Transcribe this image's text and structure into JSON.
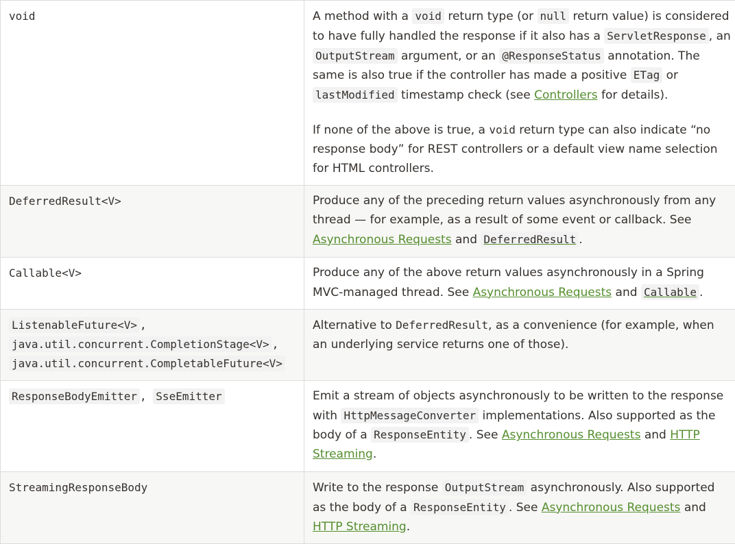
{
  "rows": [
    {
      "key": [
        "void"
      ],
      "desc": [
        [
          {
            "t": "A method with a "
          },
          {
            "c": "void"
          },
          {
            "t": " return type (or "
          },
          {
            "c": "null"
          },
          {
            "t": " return value) is considered to have fully handled the response if it also has a "
          },
          {
            "c": "ServletResponse"
          },
          {
            "t": ", an "
          },
          {
            "c": "OutputStream"
          },
          {
            "t": " argument, or an "
          },
          {
            "c": "@ResponseStatus"
          },
          {
            "t": " annotation. The same is also true if the controller has made a positive "
          },
          {
            "c": "ETag"
          },
          {
            "t": " or "
          },
          {
            "c": "lastModified"
          },
          {
            "t": " timestamp check (see "
          },
          {
            "a": "Controllers"
          },
          {
            "t": " for details)."
          }
        ],
        [
          {
            "t": "If none of the above is true, a "
          },
          {
            "b": "void"
          },
          {
            "t": " return type can also indicate “no response body” for REST controllers or a default view name selection for HTML controllers."
          }
        ]
      ]
    },
    {
      "key": [
        "DeferredResult<V>"
      ],
      "desc": [
        [
          {
            "t": "Produce any of the preceding return values asynchronously from any thread — for example, as a result of some event or callback. See "
          },
          {
            "a": "Asynchronous Requests"
          },
          {
            "t": " and "
          },
          {
            "ac": "DeferredResult"
          },
          {
            "t": "."
          }
        ]
      ]
    },
    {
      "key": [
        "Callable<V>"
      ],
      "desc": [
        [
          {
            "t": "Produce any of the above return values asynchronously in a Spring MVC-managed thread. See "
          },
          {
            "a": "Asynchronous Requests"
          },
          {
            "t": " and "
          },
          {
            "ac": "Callable"
          },
          {
            "t": "."
          }
        ]
      ]
    },
    {
      "key": [
        "ListenableFuture<V>",
        "java.util.concurrent.CompletionStage<V>",
        "java.util.concurrent.CompletableFuture<V>"
      ],
      "desc": [
        [
          {
            "t": "Alternative to "
          },
          {
            "b": "DeferredResult"
          },
          {
            "t": ", as a convenience (for example, when an underlying service returns one of those)."
          }
        ]
      ]
    },
    {
      "key": [
        "ResponseBodyEmitter",
        "SseEmitter"
      ],
      "desc": [
        [
          {
            "t": "Emit a stream of objects asynchronously to be written to the response with "
          },
          {
            "c": "HttpMessageConverter"
          },
          {
            "t": " implementations. Also supported as the body of a "
          },
          {
            "c": "ResponseEntity"
          },
          {
            "t": ". See "
          },
          {
            "a": "Asynchronous Requests"
          },
          {
            "t": " and "
          },
          {
            "a": "HTTP Streaming"
          },
          {
            "t": "."
          }
        ]
      ]
    },
    {
      "key": [
        "StreamingResponseBody"
      ],
      "desc": [
        [
          {
            "t": "Write to the response "
          },
          {
            "c": "OutputStream"
          },
          {
            "t": " asynchronously. Also supported as the body of a "
          },
          {
            "c": "ResponseEntity"
          },
          {
            "t": ". See "
          },
          {
            "a": "Asynchronous Requests"
          },
          {
            "t": " and "
          },
          {
            "a": "HTTP Streaming"
          },
          {
            "t": "."
          }
        ]
      ]
    }
  ],
  "colors": {
    "link": "#548e2e",
    "text": "#34302d",
    "border": "#dcdcdc",
    "alt_row": "#f7f7f5"
  }
}
